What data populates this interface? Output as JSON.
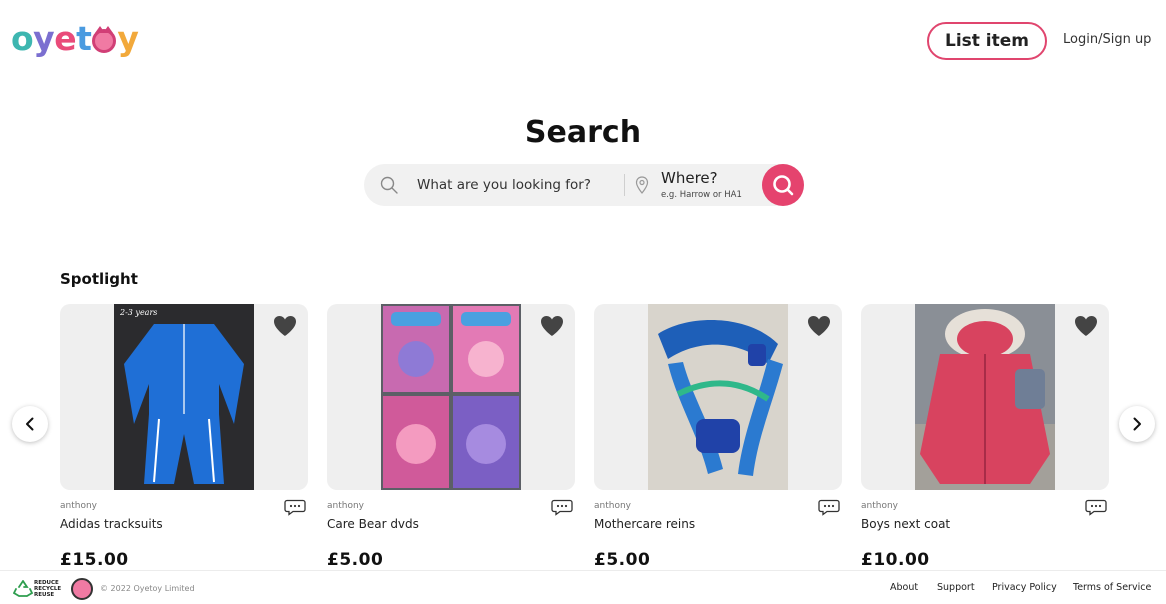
{
  "header": {
    "logo_text": "oyetoy",
    "list_item_label": "List item",
    "login_label": "Login/Sign up"
  },
  "search": {
    "title": "Search",
    "query_placeholder": "What are you looking for?",
    "where_label": "Where?",
    "where_placeholder": "e.g. Harrow or HA1"
  },
  "spotlight": {
    "title": "Spotlight",
    "items": [
      {
        "seller": "anthony",
        "title": "Adidas tracksuits",
        "price": "£15.00",
        "photo_caption": "2-3 years"
      },
      {
        "seller": "anthony",
        "title": "Care Bear dvds",
        "price": "£5.00"
      },
      {
        "seller": "anthony",
        "title": "Mothercare reins",
        "price": "£5.00"
      },
      {
        "seller": "anthony",
        "title": "Boys next coat",
        "price": "£10.00"
      }
    ]
  },
  "footer": {
    "recycle_line1": "REDUCE",
    "recycle_line2": "RECYCLE",
    "recycle_line3": "REUSE",
    "copyright": "© 2022 Oyetoy Limited",
    "links": [
      "About",
      "Support",
      "Privacy Policy",
      "Terms of Service"
    ]
  },
  "colors": {
    "accent": "#e5436e",
    "card_bg": "#efefef"
  }
}
